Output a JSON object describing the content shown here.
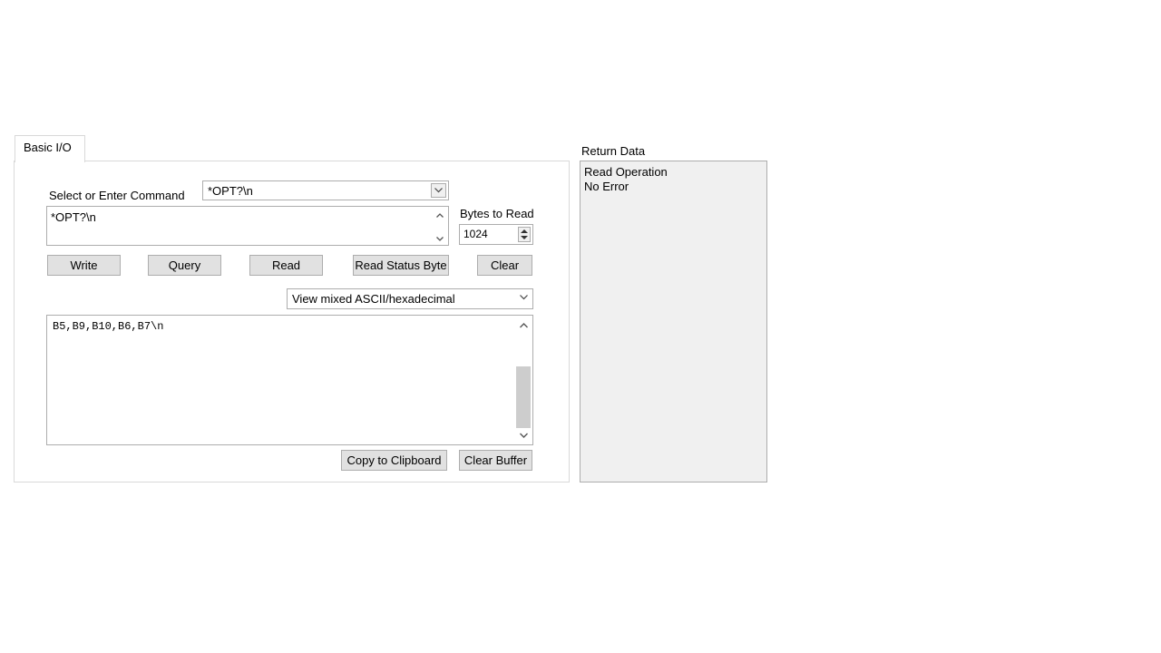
{
  "tabs": [
    {
      "label": "Basic I/O",
      "active": true
    }
  ],
  "command": {
    "label": "Select or Enter Command",
    "combo_value": "*OPT?\\n",
    "text_value": "*OPT?\\n"
  },
  "bytes_to_read": {
    "label": "Bytes to Read",
    "value": "1024"
  },
  "buttons": {
    "write": "Write",
    "query": "Query",
    "read": "Read",
    "read_status_byte": "Read Status Byte",
    "clear": "Clear"
  },
  "view_mode": {
    "selected": "View mixed ASCII/hexadecimal"
  },
  "buffer": {
    "content": "B5,B9,B10,B6,B7\\n",
    "copy_label": "Copy to Clipboard",
    "clear_label": "Clear Buffer"
  },
  "return_data": {
    "label": "Return Data",
    "lines": [
      "Read Operation",
      "No Error"
    ]
  }
}
